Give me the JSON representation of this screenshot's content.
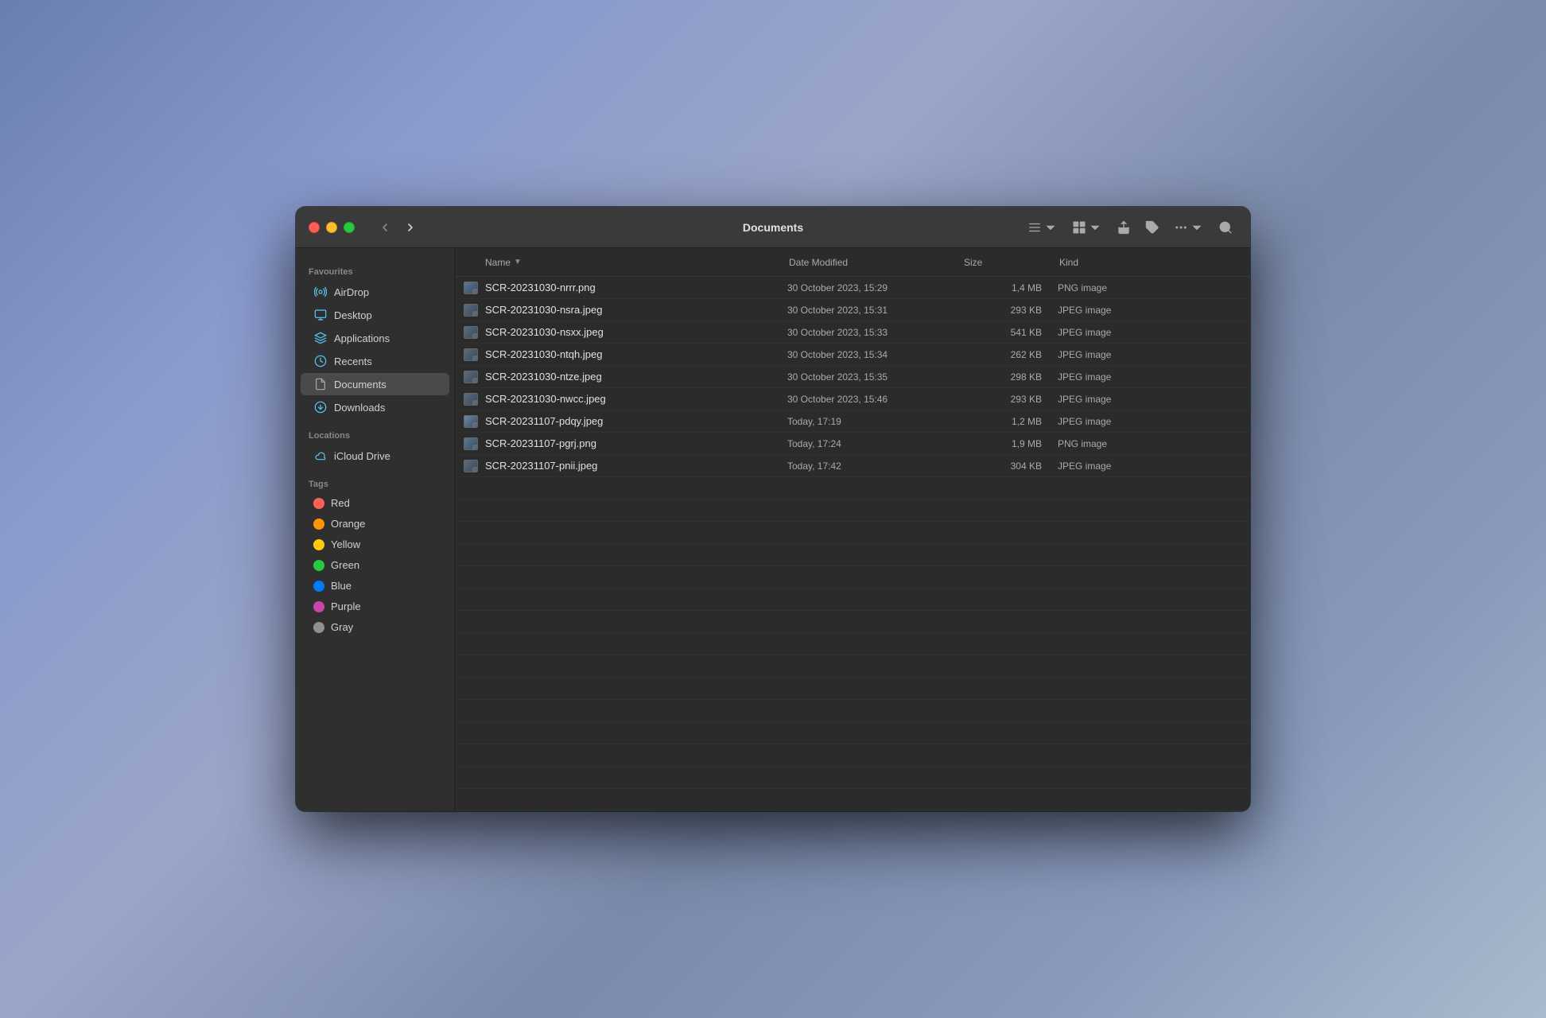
{
  "window": {
    "title": "Documents"
  },
  "sidebar": {
    "favourites_label": "Favourites",
    "locations_label": "Locations",
    "tags_label": "Tags",
    "items_favourites": [
      {
        "id": "airdrop",
        "label": "AirDrop",
        "icon": "airdrop"
      },
      {
        "id": "desktop",
        "label": "Desktop",
        "icon": "desktop"
      },
      {
        "id": "applications",
        "label": "Applications",
        "icon": "applications"
      },
      {
        "id": "recents",
        "label": "Recents",
        "icon": "recents"
      },
      {
        "id": "documents",
        "label": "Documents",
        "icon": "documents",
        "active": true
      },
      {
        "id": "downloads",
        "label": "Downloads",
        "icon": "downloads"
      }
    ],
    "items_locations": [
      {
        "id": "icloud",
        "label": "iCloud Drive",
        "icon": "icloud"
      }
    ],
    "items_tags": [
      {
        "id": "red",
        "label": "Red",
        "color": "#ff5f57"
      },
      {
        "id": "orange",
        "label": "Orange",
        "color": "#ff9500"
      },
      {
        "id": "yellow",
        "label": "Yellow",
        "color": "#ffcc00"
      },
      {
        "id": "green",
        "label": "Green",
        "color": "#28c840"
      },
      {
        "id": "blue",
        "label": "Blue",
        "color": "#007aff"
      },
      {
        "id": "purple",
        "label": "Purple",
        "color": "#cc44aa"
      },
      {
        "id": "gray",
        "label": "Gray",
        "color": "#8e8e93"
      }
    ]
  },
  "columns": {
    "name": "Name",
    "date_modified": "Date Modified",
    "size": "Size",
    "kind": "Kind"
  },
  "files": [
    {
      "name": "SCR-20231030-nrrr.png",
      "date": "30 October 2023, 15:29",
      "size": "1,4 MB",
      "kind": "PNG image",
      "type": "png"
    },
    {
      "name": "SCR-20231030-nsra.jpeg",
      "date": "30 October 2023, 15:31",
      "size": "293 KB",
      "kind": "JPEG image",
      "type": "jpeg"
    },
    {
      "name": "SCR-20231030-nsxx.jpeg",
      "date": "30 October 2023, 15:33",
      "size": "541 KB",
      "kind": "JPEG image",
      "type": "jpeg"
    },
    {
      "name": "SCR-20231030-ntqh.jpeg",
      "date": "30 October 2023, 15:34",
      "size": "262 KB",
      "kind": "JPEG image",
      "type": "jpeg"
    },
    {
      "name": "SCR-20231030-ntze.jpeg",
      "date": "30 October 2023, 15:35",
      "size": "298 KB",
      "kind": "JPEG image",
      "type": "jpeg"
    },
    {
      "name": "SCR-20231030-nwcc.jpeg",
      "date": "30 October 2023, 15:46",
      "size": "293 KB",
      "kind": "JPEG image",
      "type": "jpeg"
    },
    {
      "name": "SCR-20231107-pdqy.jpeg",
      "date": "Today, 17:19",
      "size": "1,2 MB",
      "kind": "JPEG image",
      "type": "preview"
    },
    {
      "name": "SCR-20231107-pgrj.png",
      "date": "Today, 17:24",
      "size": "1,9 MB",
      "kind": "PNG image",
      "type": "png"
    },
    {
      "name": "SCR-20231107-pnii.jpeg",
      "date": "Today, 17:42",
      "size": "304 KB",
      "kind": "JPEG image",
      "type": "jpeg"
    }
  ],
  "toolbar": {
    "back_label": "‹",
    "forward_label": "›"
  }
}
